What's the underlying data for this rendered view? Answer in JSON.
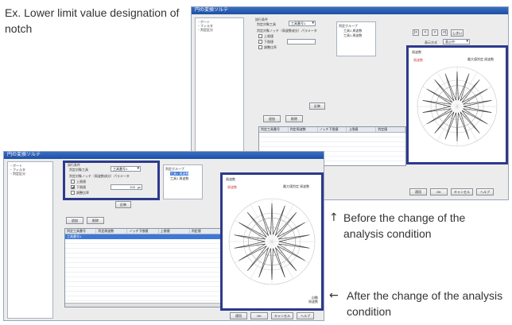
{
  "captions": {
    "top": "Ex. Lower limit value designation of notch",
    "before": "Before the change of the analysis condition",
    "after": "After the change of the analysis condition",
    "arrow_up": "↑",
    "arrow_left": "←"
  },
  "window": {
    "title": "円の変換ソルテ",
    "tree_items": [
      "・ポート",
      "・フィルタ",
      "・判定区分"
    ],
    "group_title": "試行条件",
    "tool_label": "判定対象工具",
    "tool_value": "工具番号1",
    "notch_label": "判定対象ノッチ（周波数成分）パラメータ",
    "upper_label": "上限値",
    "lower_label": "下限値",
    "lower_value": "100",
    "lower_unit": "μs",
    "ratio_label": "調整比率",
    "tree_root": "判定グループ",
    "tree_child1": "工具1 周波数",
    "tree_child2": "工具1 周波数",
    "mode_label": "表示方式",
    "mode_value": "表示中",
    "nav_buttons": [
      "|<",
      "<",
      ">",
      ">|",
      "しきい"
    ],
    "add_button": "追加",
    "delete_button": "削除",
    "apply_button": "反映",
    "columns": [
      "判定工具番号",
      "判定周波数",
      "ノッチ下限値",
      "上限値",
      "判定値"
    ],
    "selected_row": [
      "工具番号1",
      "",
      "",
      "",
      ""
    ],
    "chart_title": "周波数",
    "chart_legend": "最大値判定 周波数",
    "chart_red_label": "周波数",
    "chart_unit": "自動\n周波数",
    "footer_buttons": [
      "適用",
      "OK",
      "キャンセル",
      "ヘルプ"
    ]
  }
}
